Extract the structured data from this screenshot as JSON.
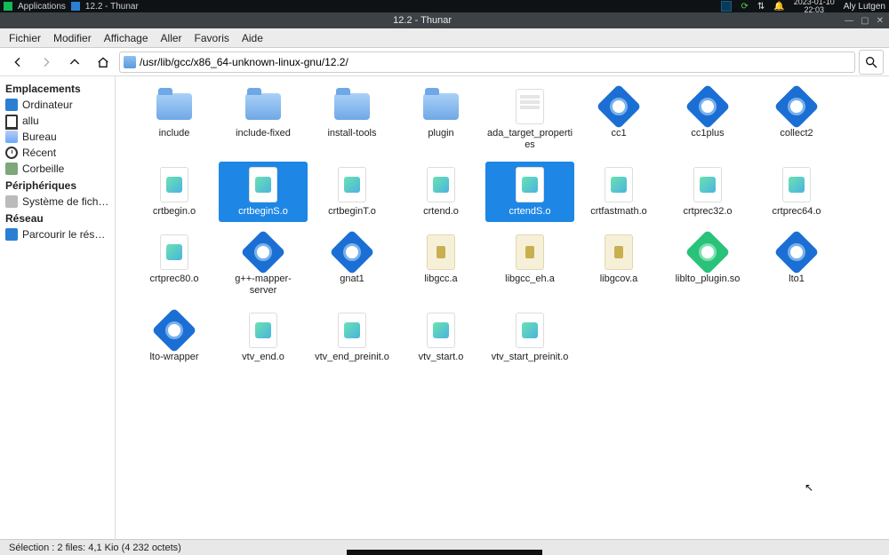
{
  "top_panel": {
    "applications": "Applications",
    "task_title": "12.2 - Thunar",
    "date": "2023-01-10",
    "time": "22:03",
    "user": "Aly Lutgen"
  },
  "titlebar": {
    "title": "12.2 - Thunar"
  },
  "menubar": [
    "Fichier",
    "Modifier",
    "Affichage",
    "Aller",
    "Favoris",
    "Aide"
  ],
  "path": "/usr/lib/gcc/x86_64-unknown-linux-gnu/12.2/",
  "sidebar": {
    "sections": [
      {
        "heading": "Emplacements",
        "items": [
          {
            "icon": "computer",
            "label": "Ordinateur"
          },
          {
            "icon": "home",
            "label": "allu"
          },
          {
            "icon": "desktop",
            "label": "Bureau"
          },
          {
            "icon": "recent",
            "label": "Récent"
          },
          {
            "icon": "trash",
            "label": "Corbeille"
          }
        ]
      },
      {
        "heading": "Périphériques",
        "items": [
          {
            "icon": "fs",
            "label": "Système de fichi…"
          }
        ]
      },
      {
        "heading": "Réseau",
        "items": [
          {
            "icon": "net",
            "label": "Parcourir le réseau"
          }
        ]
      }
    ]
  },
  "files": [
    {
      "name": "include",
      "type": "folder"
    },
    {
      "name": "include-fixed",
      "type": "folder"
    },
    {
      "name": "install-tools",
      "type": "folder"
    },
    {
      "name": "plugin",
      "type": "folder"
    },
    {
      "name": "ada_target_properties",
      "type": "doc"
    },
    {
      "name": "cc1",
      "type": "exec"
    },
    {
      "name": "cc1plus",
      "type": "exec"
    },
    {
      "name": "collect2",
      "type": "exec"
    },
    {
      "name": "crtbegin.o",
      "type": "obj"
    },
    {
      "name": "crtbeginS.o",
      "type": "obj",
      "selected": true
    },
    {
      "name": "crtbeginT.o",
      "type": "obj"
    },
    {
      "name": "crtend.o",
      "type": "obj"
    },
    {
      "name": "crtendS.o",
      "type": "obj",
      "selected": true
    },
    {
      "name": "crtfastmath.o",
      "type": "obj"
    },
    {
      "name": "crtprec32.o",
      "type": "obj"
    },
    {
      "name": "crtprec64.o",
      "type": "obj"
    },
    {
      "name": "crtprec80.o",
      "type": "obj"
    },
    {
      "name": "g++-mapper-server",
      "type": "exec"
    },
    {
      "name": "gnat1",
      "type": "exec"
    },
    {
      "name": "libgcc.a",
      "type": "lib"
    },
    {
      "name": "libgcc_eh.a",
      "type": "lib"
    },
    {
      "name": "libgcov.a",
      "type": "lib"
    },
    {
      "name": "liblto_plugin.so",
      "type": "plugin"
    },
    {
      "name": "lto1",
      "type": "exec"
    },
    {
      "name": "lto-wrapper",
      "type": "exec"
    },
    {
      "name": "vtv_end.o",
      "type": "obj"
    },
    {
      "name": "vtv_end_preinit.o",
      "type": "obj"
    },
    {
      "name": "vtv_start.o",
      "type": "obj"
    },
    {
      "name": "vtv_start_preinit.o",
      "type": "obj"
    }
  ],
  "statusbar": "Sélection : 2 files: 4,1 Kio (4 232 octets)"
}
